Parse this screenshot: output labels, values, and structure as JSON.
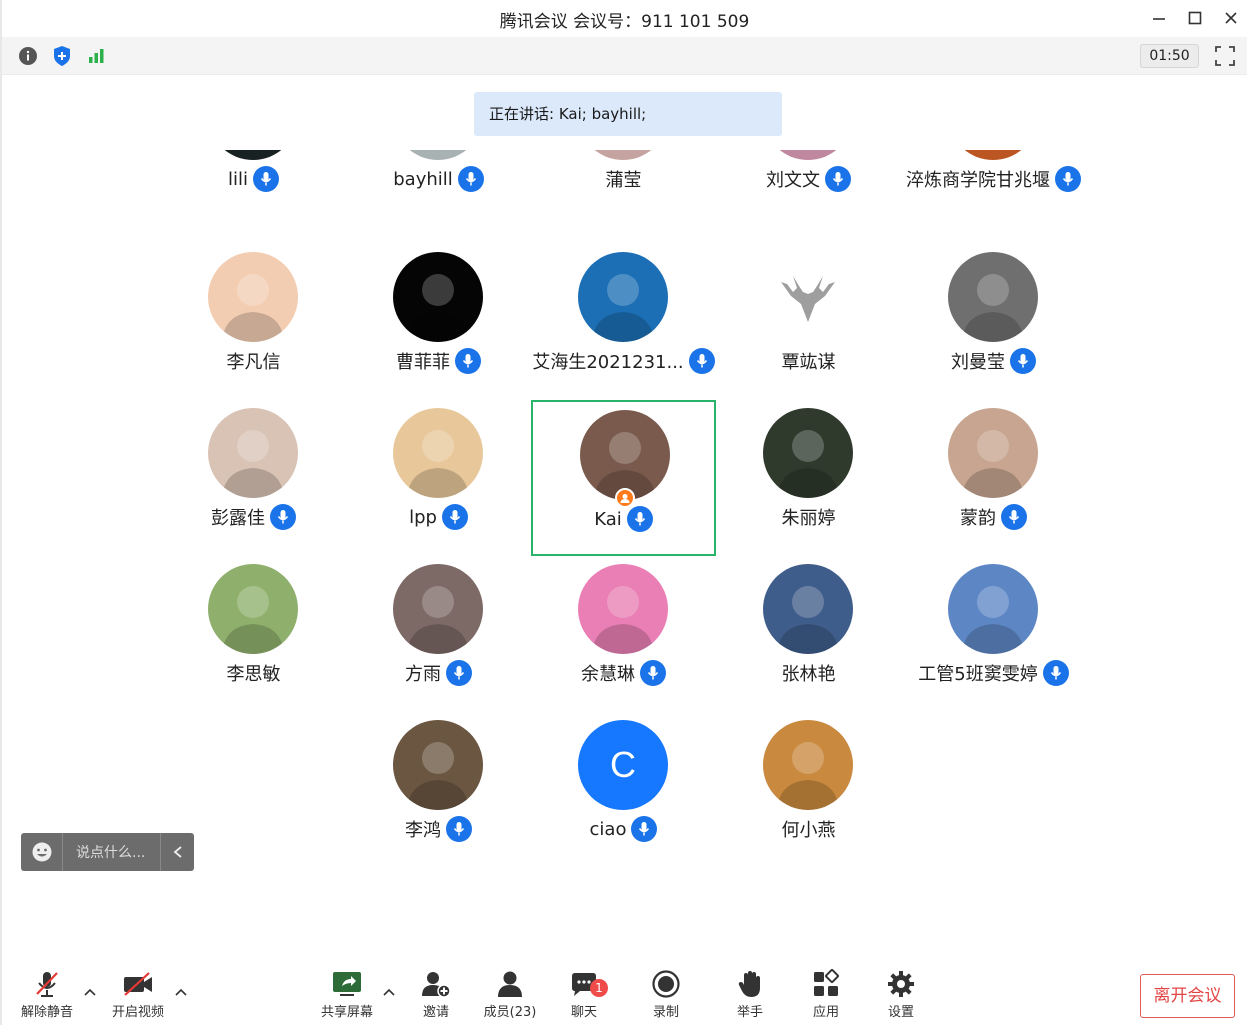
{
  "window": {
    "title": "腾讯会议 会议号：911 101 509"
  },
  "infobar": {
    "timer": "01:50"
  },
  "speaking": {
    "text": "正在讲话: Kai; bayhill;"
  },
  "participants": [
    {
      "name": "lili",
      "mic": true,
      "avatar": "#1f2a2a"
    },
    {
      "name": "bayhill",
      "mic": true,
      "avatar": "#cfd9da"
    },
    {
      "name": "蒲莹",
      "mic": false,
      "avatar": "#f0c7c4"
    },
    {
      "name": "刘文文",
      "mic": true,
      "avatar": "#e9a6c2"
    },
    {
      "name": "淬炼商学院甘兆堰",
      "mic": true,
      "avatar": "#e56a2a"
    },
    {
      "name": "李凡信",
      "mic": false,
      "avatar": "#f3cdb2"
    },
    {
      "name": "曹菲菲",
      "mic": true,
      "avatar": "#050505"
    },
    {
      "name": "艾海生2021231...",
      "mic": true,
      "avatar": "#1c6fb5"
    },
    {
      "name": "覃竑谋",
      "mic": false,
      "avatar": "#ffffff"
    },
    {
      "name": "刘曼莹",
      "mic": true,
      "avatar": "#6f6f6f"
    },
    {
      "name": "彭露佳",
      "mic": true,
      "avatar": "#d9c3b5"
    },
    {
      "name": "lpp",
      "mic": true,
      "avatar": "#e8c89a"
    },
    {
      "name": "Kai",
      "mic": true,
      "avatar": "#7a5a4c"
    },
    {
      "name": "朱丽婷",
      "mic": false,
      "avatar": "#2f3a2d"
    },
    {
      "name": "蒙韵",
      "mic": true,
      "avatar": "#c7a590"
    },
    {
      "name": "李思敏",
      "mic": false,
      "avatar": "#8fb06c"
    },
    {
      "name": "方雨",
      "mic": true,
      "avatar": "#7d6a66"
    },
    {
      "name": "余慧琳",
      "mic": true,
      "avatar": "#e97fb4"
    },
    {
      "name": "张林艳",
      "mic": false,
      "avatar": "#3f5d8a"
    },
    {
      "name": "工管5班窦雯婷",
      "mic": true,
      "avatar": "#5d87c4"
    },
    {
      "name": "李鸿",
      "mic": true,
      "avatar": "#6b5642"
    },
    {
      "name": "ciao",
      "mic": true,
      "avatar": "#1677ff",
      "initial": "C"
    },
    {
      "name": "何小燕",
      "mic": false,
      "avatar": "#c98a3f"
    }
  ],
  "chat": {
    "placeholder": "说点什么..."
  },
  "toolbar": {
    "unmute": "解除静音",
    "video": "开启视频",
    "share": "共享屏幕",
    "invite": "邀请",
    "members": "成员(23)",
    "chat": "聊天",
    "chat_badge": "1",
    "record": "录制",
    "raise_hand": "举手",
    "apps": "应用",
    "settings": "设置",
    "leave": "离开会议"
  },
  "colors": {
    "accent": "#1a73e8",
    "active_border": "#29b36b",
    "leave_red": "#e34545"
  }
}
